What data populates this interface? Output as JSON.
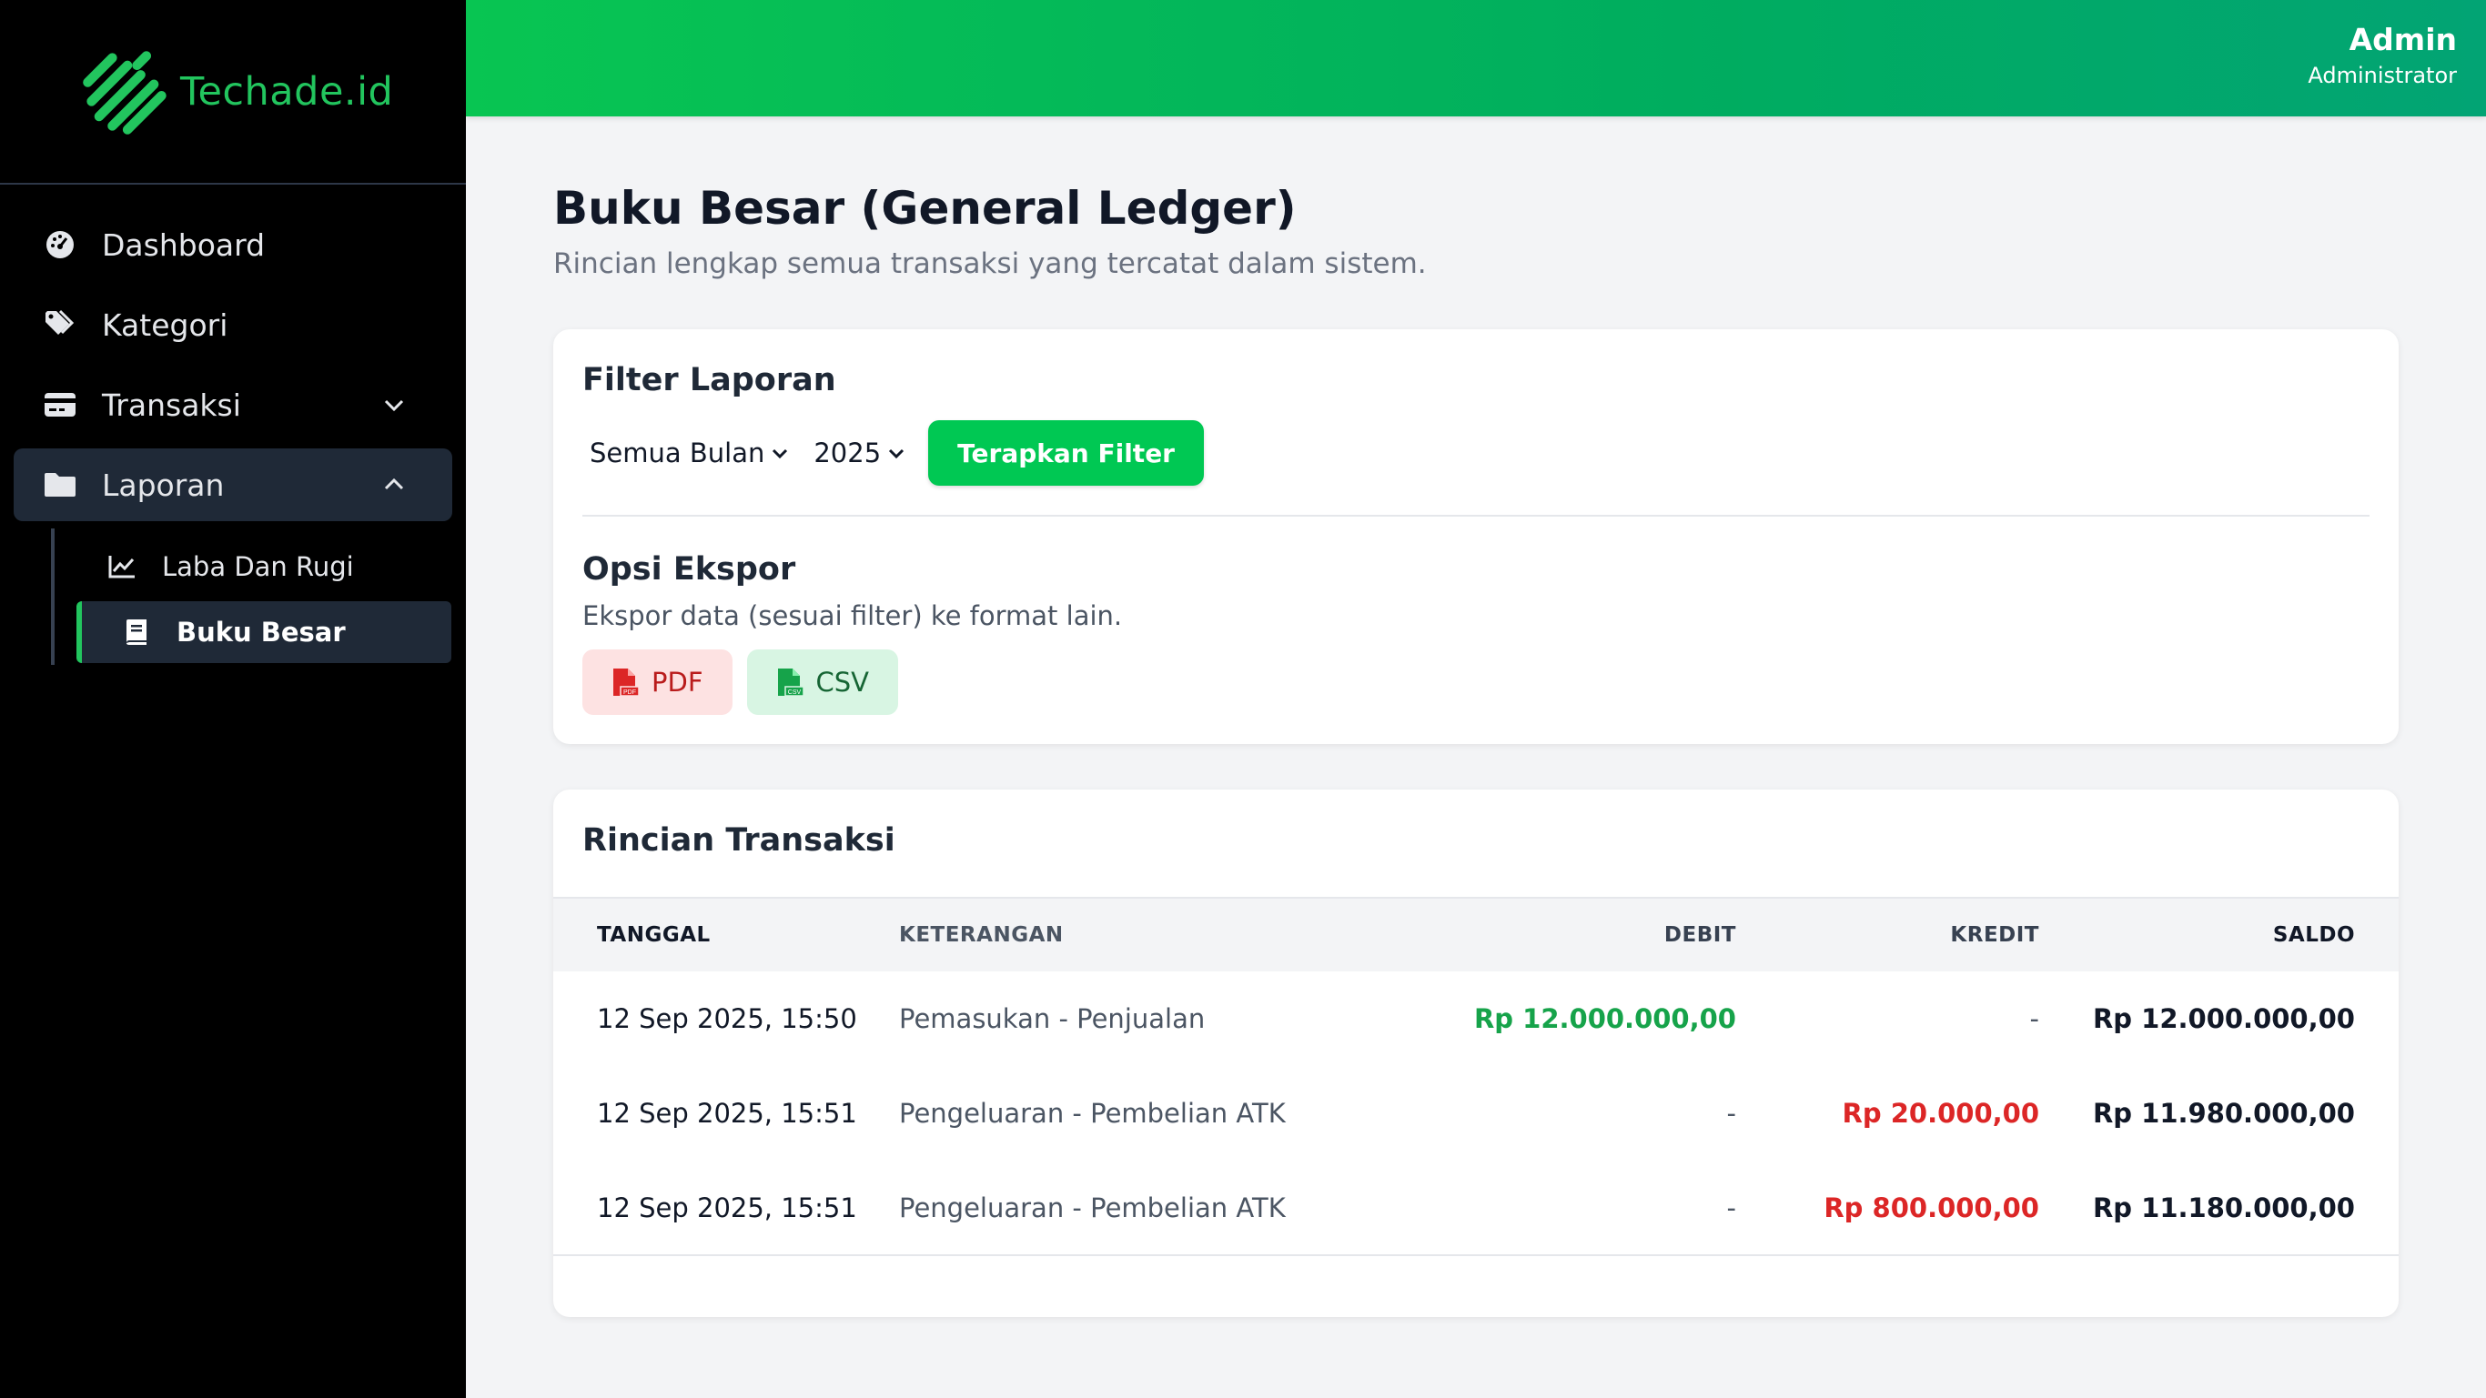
{
  "brand": {
    "name": "Techade.id",
    "accent": "#22c55e"
  },
  "user": {
    "name": "Admin",
    "role": "Administrator"
  },
  "sidebar": {
    "items": [
      {
        "label": "Dashboard",
        "icon": "gauge-icon"
      },
      {
        "label": "Kategori",
        "icon": "tags-icon"
      },
      {
        "label": "Transaksi",
        "icon": "credit-card-icon",
        "expanded": false
      },
      {
        "label": "Laporan",
        "icon": "folder-icon",
        "expanded": true,
        "active": true
      }
    ],
    "sub_items": [
      {
        "label": "Laba Dan Rugi",
        "icon": "chart-line-icon"
      },
      {
        "label": "Buku Besar",
        "icon": "book-icon",
        "active": true
      }
    ]
  },
  "page": {
    "title": "Buku Besar (General Ledger)",
    "subtitle": "Rincian lengkap semua transaksi yang tercatat dalam sistem."
  },
  "filter": {
    "title": "Filter Laporan",
    "month_selected": "Semua Bulan",
    "year_selected": "2025",
    "apply_label": "Terapkan Filter"
  },
  "export": {
    "title": "Opsi Ekspor",
    "description": "Ekspor data (sesuai filter) ke format lain.",
    "pdf_label": "PDF",
    "csv_label": "CSV"
  },
  "transactions": {
    "title": "Rincian Transaksi",
    "columns": [
      "Tanggal",
      "Keterangan",
      "Debit",
      "Kredit",
      "Saldo"
    ],
    "rows": [
      {
        "date": "12 Sep 2025, 15:50",
        "desc": "Pemasukan - Penjualan",
        "debit": "Rp 12.000.000,00",
        "kredit": "-",
        "saldo": "Rp 12.000.000,00"
      },
      {
        "date": "12 Sep 2025, 15:51",
        "desc": "Pengeluaran - Pembelian ATK",
        "debit": "-",
        "kredit": "Rp 20.000,00",
        "saldo": "Rp 11.980.000,00"
      },
      {
        "date": "12 Sep 2025, 15:51",
        "desc": "Pengeluaran - Pembelian ATK",
        "debit": "-",
        "kredit": "Rp 800.000,00",
        "saldo": "Rp 11.180.000,00"
      }
    ]
  },
  "colors": {
    "header_start": "#08c552",
    "header_end": "#02a474",
    "debit": "#16a34a",
    "kredit": "#dc2626",
    "apply_button": "#00c853"
  }
}
